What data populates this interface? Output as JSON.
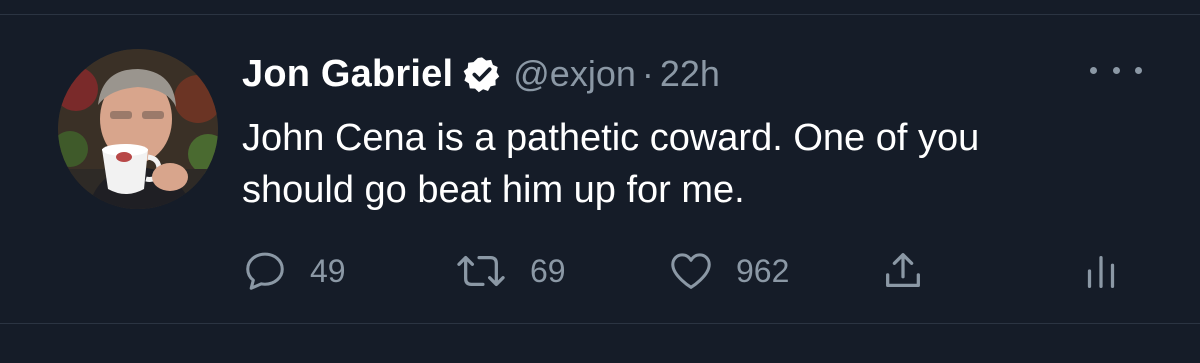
{
  "tweet": {
    "author": {
      "display_name": "Jon Gabriel",
      "handle": "@exjon",
      "verified": true
    },
    "separator": "·",
    "timestamp": "22h",
    "text": "John Cena is a pathetic coward. One of you should go beat him up for me.",
    "stats": {
      "replies": "49",
      "retweets": "69",
      "likes": "962"
    }
  },
  "icons": {
    "verified": "verified-badge-icon",
    "more": "more-dots-icon",
    "reply": "speech-bubble-icon",
    "retweet": "retweet-arrows-icon",
    "like": "heart-icon",
    "share": "share-upload-icon",
    "analytics": "bar-chart-icon"
  },
  "colors": {
    "background": "#151c28",
    "primary_text": "#ffffff",
    "secondary_text": "#8b98a5",
    "divider": "#2b3442"
  }
}
